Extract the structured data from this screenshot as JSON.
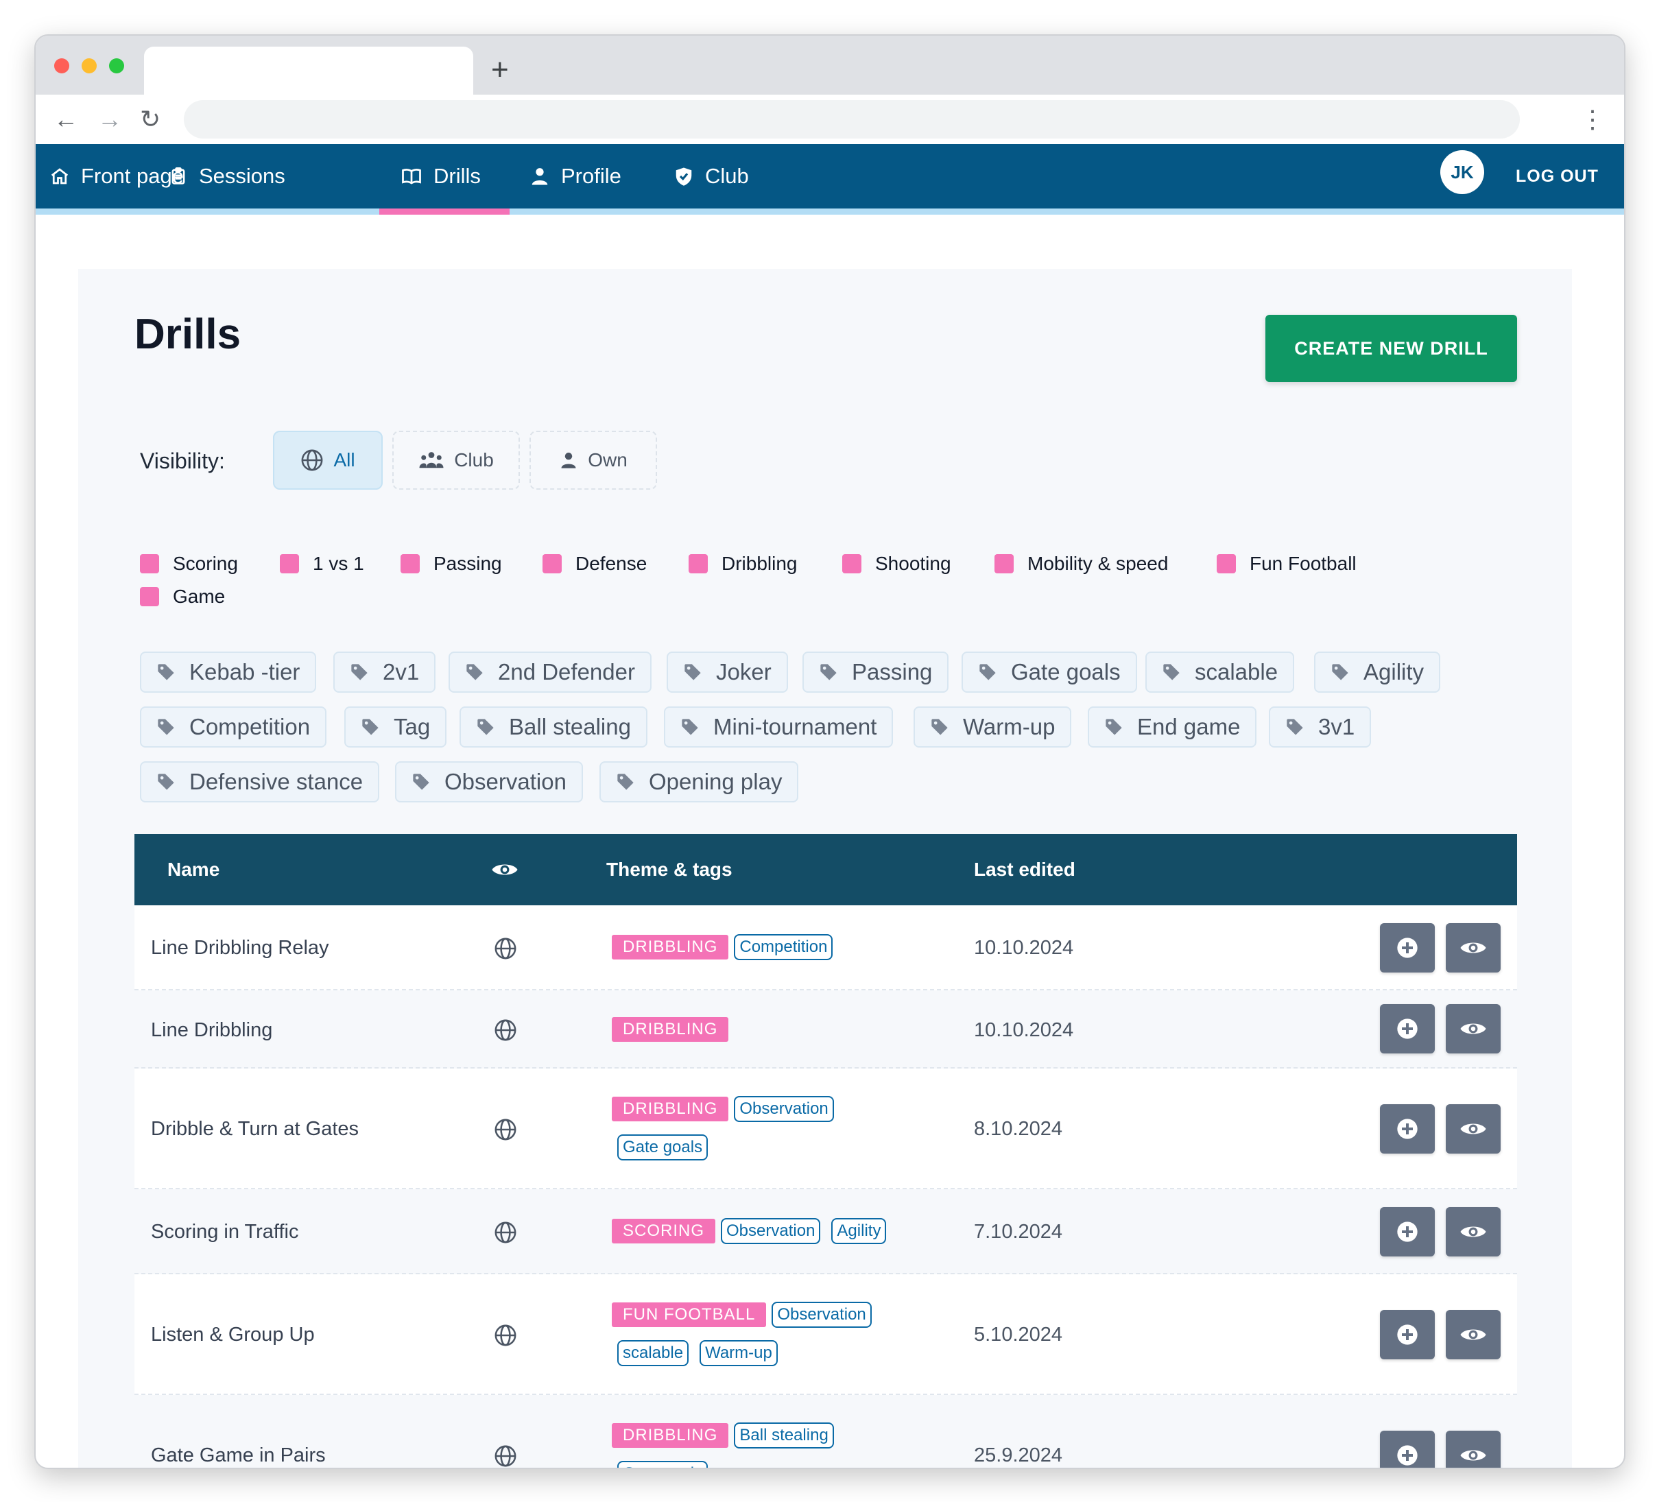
{
  "nav": {
    "items": [
      {
        "label": "Front page",
        "icon": "home-icon"
      },
      {
        "label": "Sessions",
        "icon": "clipboard-icon"
      },
      {
        "label": "Drills",
        "icon": "book-icon"
      },
      {
        "label": "Profile",
        "icon": "user-icon"
      },
      {
        "label": "Club",
        "icon": "shield-icon"
      }
    ],
    "active": "Drills",
    "avatar_initials": "JK",
    "logout_label": "LOG OUT"
  },
  "page": {
    "title": "Drills",
    "create_button": "CREATE NEW DRILL"
  },
  "visibility": {
    "label": "Visibility:",
    "options": [
      {
        "label": "All",
        "icon": "globe-icon",
        "active": true
      },
      {
        "label": "Club",
        "icon": "users-icon",
        "active": false
      },
      {
        "label": "Own",
        "icon": "user-icon",
        "active": false
      }
    ]
  },
  "themes": [
    "Scoring",
    "1 vs 1",
    "Passing",
    "Defense",
    "Dribbling",
    "Shooting",
    "Mobility & speed",
    "Fun Football",
    "Game"
  ],
  "tags": [
    "Kebab -tier",
    "2v1",
    "2nd Defender",
    "Joker",
    "Passing",
    "Gate goals",
    "scalable",
    "Agility",
    "Competition",
    "Tag",
    "Ball stealing",
    "Mini-tournament",
    "Warm-up",
    "End game",
    "3v1",
    "Defensive stance",
    "Observation",
    "Opening play"
  ],
  "table": {
    "headers": {
      "name": "Name",
      "visibility_icon": "eye-icon",
      "theme_tags": "Theme & tags",
      "last_edited": "Last edited"
    },
    "rows": [
      {
        "name": "Line Dribbling Relay",
        "visibility": "globe-icon",
        "theme": "DRIBBLING",
        "tags": [
          "Competition"
        ],
        "last_edited": "10.10.2024"
      },
      {
        "name": "Line Dribbling",
        "visibility": "globe-icon",
        "theme": "DRIBBLING",
        "tags": [],
        "last_edited": "10.10.2024"
      },
      {
        "name": "Dribble & Turn at Gates",
        "visibility": "globe-icon",
        "theme": "DRIBBLING",
        "tags": [
          "Observation",
          "Gate goals"
        ],
        "last_edited": "8.10.2024"
      },
      {
        "name": "Scoring in Traffic",
        "visibility": "globe-icon",
        "theme": "SCORING",
        "tags": [
          "Observation",
          "Agility"
        ],
        "last_edited": "7.10.2024"
      },
      {
        "name": "Listen & Group Up",
        "visibility": "globe-icon",
        "theme": "FUN FOOTBALL",
        "tags": [
          "Observation",
          "scalable",
          "Warm-up"
        ],
        "last_edited": "5.10.2024"
      },
      {
        "name": "Gate Game in Pairs",
        "visibility": "globe-icon",
        "theme": "DRIBBLING",
        "tags": [
          "Ball stealing",
          "Gate goals"
        ],
        "last_edited": "25.9.2024"
      }
    ],
    "row_actions": [
      {
        "icon": "plus-circle-icon"
      },
      {
        "icon": "eye-icon"
      }
    ]
  },
  "colors": {
    "nav_bg": "#055785",
    "nav_underline": "#b3ddf5",
    "active_indicator": "#f472b6",
    "create_button": "#0f9764",
    "table_header": "#144d66",
    "theme_badge": "#f472b6",
    "tag_outline": "#0a6aa6",
    "action_button": "#647083"
  }
}
